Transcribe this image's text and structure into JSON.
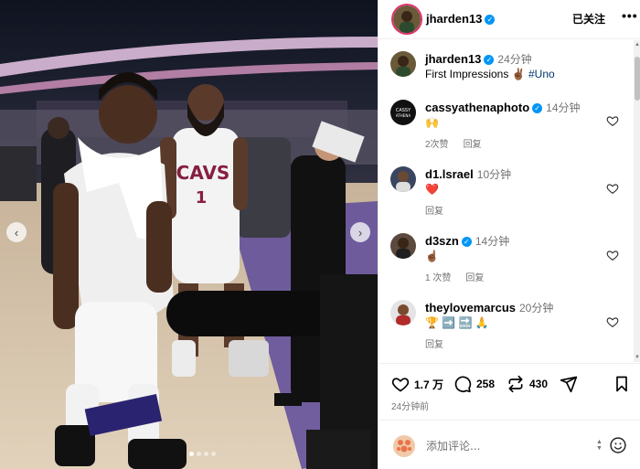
{
  "post": {
    "author": "jharden13",
    "follow_label": "已关注",
    "more_label": "•••",
    "caption_time": "24分钟",
    "caption_text": "First Impressions ",
    "caption_emoji": "✌🏾",
    "caption_hashtag": "#Uno",
    "likes": "1.7 万",
    "comments_count": "258",
    "reposts_count": "430",
    "posted_ago": "24分钟前",
    "comment_placeholder": "添加评论..."
  },
  "comments": [
    {
      "username": "cassyathenaphoto",
      "verified": true,
      "time": "14分钟",
      "text": "🙌",
      "likes_label": "2次赞",
      "reply_label": "回复"
    },
    {
      "username": "d1.lsrael",
      "verified": false,
      "time": "10分钟",
      "text": "❤️",
      "reply_label": "回复"
    },
    {
      "username": "d3szn",
      "verified": true,
      "time": "14分钟",
      "text": "☝🏾",
      "likes_label": "1 次赞",
      "reply_label": "回复"
    },
    {
      "username": "theylovemarcus",
      "verified": false,
      "time": "20分钟",
      "text": "🏆 ➡️ 🔜 🙏",
      "reply_label": "回复"
    }
  ],
  "photo": {
    "jersey_team": "CAVS",
    "jersey_number": "1"
  },
  "colors": {
    "verified_blue": "#0095f6",
    "hashtag": "#00376b",
    "muted_text": "#737373",
    "like_heart": "#ed4956"
  }
}
